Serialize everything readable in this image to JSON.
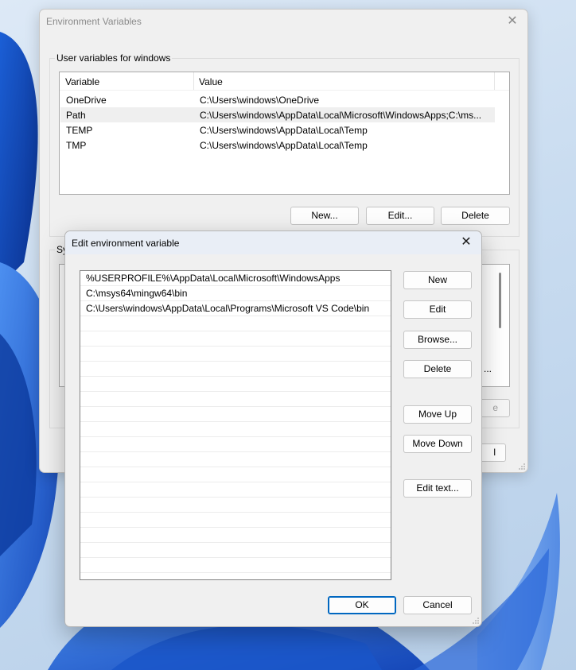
{
  "env_window": {
    "title": "Environment Variables",
    "user_group_label": "User variables for windows",
    "system_group_label_partial": "Sy",
    "columns": [
      "Variable",
      "Value"
    ],
    "user_vars": [
      {
        "name": "OneDrive",
        "value": "C:\\Users\\windows\\OneDrive"
      },
      {
        "name": "Path",
        "value": "C:\\Users\\windows\\AppData\\Local\\Microsoft\\WindowsApps;C:\\ms..."
      },
      {
        "name": "TEMP",
        "value": "C:\\Users\\windows\\AppData\\Local\\Temp"
      },
      {
        "name": "TMP",
        "value": "C:\\Users\\windows\\AppData\\Local\\Temp"
      }
    ],
    "buttons": {
      "new": "New...",
      "edit": "Edit...",
      "delete": "Delete"
    },
    "partial_labels": {
      "sys_row_tail": "...",
      "sys_delete_tail": "e",
      "cancel_tail": "l"
    }
  },
  "edit_dialog": {
    "title": "Edit environment variable",
    "paths": [
      "%USERPROFILE%\\AppData\\Local\\Microsoft\\WindowsApps",
      "C:\\msys64\\mingw64\\bin",
      "C:\\Users\\windows\\AppData\\Local\\Programs\\Microsoft VS Code\\bin"
    ],
    "buttons": {
      "new": "New",
      "edit": "Edit",
      "browse": "Browse...",
      "delete": "Delete",
      "move_up": "Move Up",
      "move_down": "Move Down",
      "edit_text": "Edit text...",
      "ok": "OK",
      "cancel": "Cancel"
    }
  },
  "icons": {
    "close": "close-icon",
    "resize": "resize-grip-icon"
  },
  "colors": {
    "accent": "#0067c0",
    "wallpaper": "#2f6fd6"
  }
}
